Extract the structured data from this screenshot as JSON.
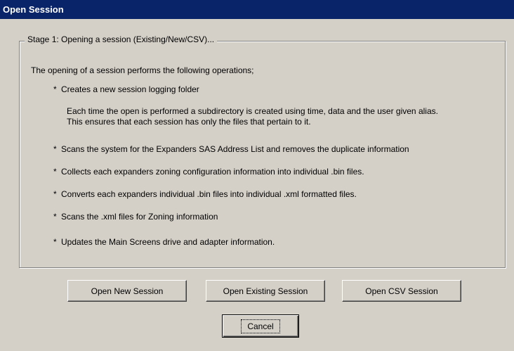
{
  "window": {
    "title": "Open Session"
  },
  "group": {
    "legend": "Stage 1: Opening a session (Existing/New/CSV)...",
    "intro": "The opening of a session performs the following operations;",
    "items": [
      {
        "bullet": "*",
        "text": "Creates a new session logging folder"
      },
      {
        "detail_line_1": "Each time the open is performed a subdirectory is created using time, data and the user given alias.",
        "detail_line_2": "This ensures that each session has only the files that pertain to it."
      },
      {
        "bullet": "*",
        "text": "Scans the system for the Expanders SAS Address List and removes the duplicate information"
      },
      {
        "bullet": "*",
        "text": "Collects each expanders zoning configuration information into individual  .bin files."
      },
      {
        "bullet": "*",
        "text": "Converts each expanders individual .bin files into individual .xml formatted files."
      },
      {
        "bullet": "*",
        "text": "Scans the .xml files for Zoning information"
      },
      {
        "bullet": "*",
        "text": "Updates the Main Screens drive and adapter information."
      }
    ]
  },
  "buttons": {
    "open_new": "Open New Session",
    "open_existing": "Open Existing Session",
    "open_csv": "Open CSV Session",
    "cancel": "Cancel"
  },
  "colors": {
    "titlebar": "#0a246a",
    "face": "#d4d0c8"
  }
}
